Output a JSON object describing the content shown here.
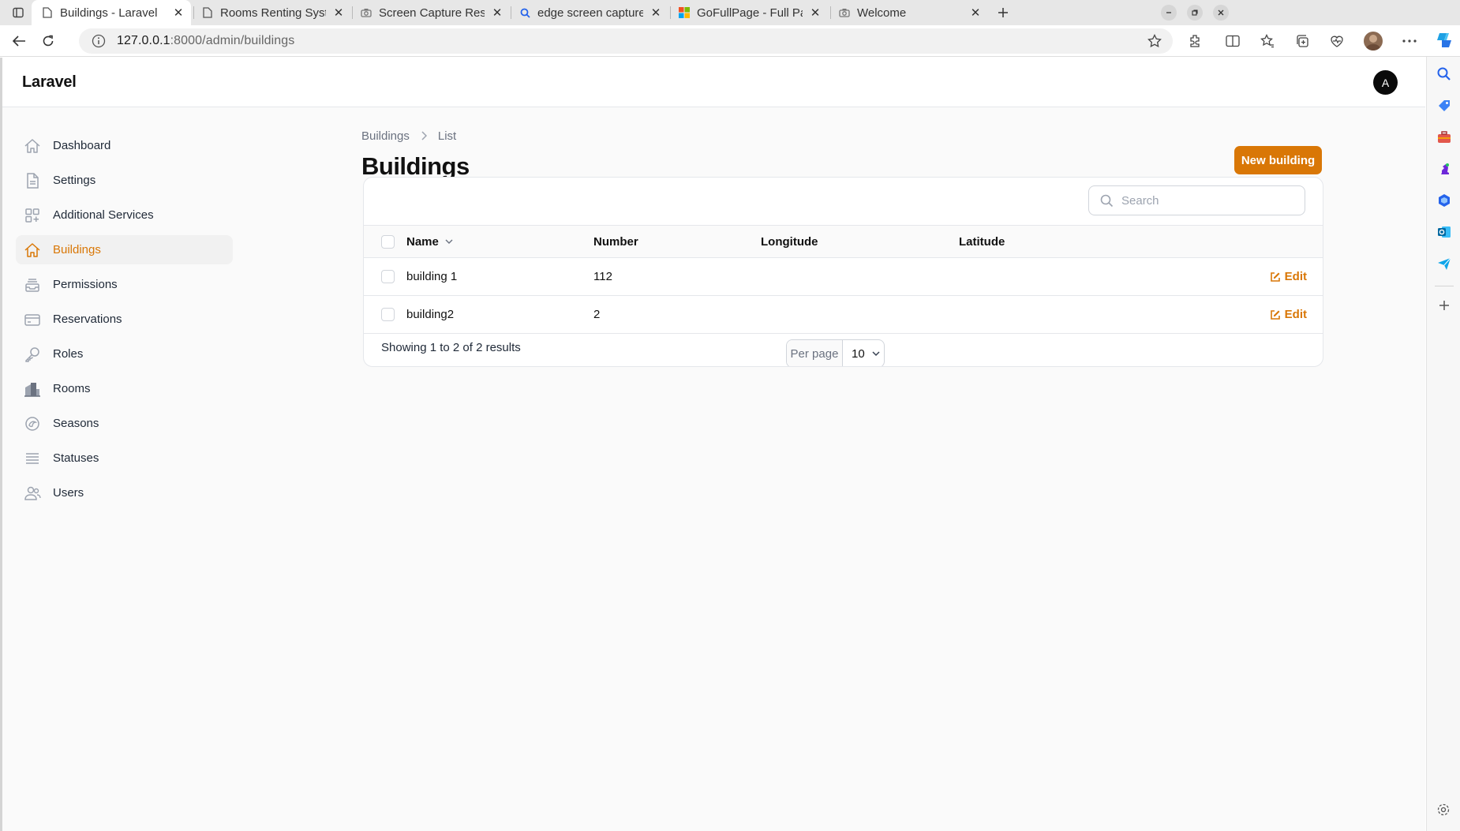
{
  "browser": {
    "tabs": [
      {
        "title": "Buildings - Laravel",
        "favicon": "page-icon",
        "active": true
      },
      {
        "title": "Rooms Renting System",
        "favicon": "page-icon",
        "active": false
      },
      {
        "title": "Screen Capture Result",
        "favicon": "camera-icon",
        "active": false
      },
      {
        "title": "edge screen capture exte",
        "favicon": "search-icon",
        "active": false
      },
      {
        "title": "GoFullPage - Full Page Scr",
        "favicon": "microsoft-icon",
        "active": false
      },
      {
        "title": "Welcome",
        "favicon": "camera-icon",
        "active": false
      }
    ],
    "url_host": "127.0.0.1",
    "url_path": ":8000/admin/buildings"
  },
  "app": {
    "brand": "Laravel",
    "avatar_initial": "A",
    "accent_color": "#d97706",
    "nav": [
      {
        "label": "Dashboard",
        "icon": "home-icon",
        "active": false
      },
      {
        "label": "Settings",
        "icon": "document-icon",
        "active": false
      },
      {
        "label": "Additional Services",
        "icon": "squares-icon",
        "active": false
      },
      {
        "label": "Buildings",
        "icon": "home-icon",
        "active": true
      },
      {
        "label": "Permissions",
        "icon": "inbox-stack-icon",
        "active": false
      },
      {
        "label": "Reservations",
        "icon": "credit-card-icon",
        "active": false
      },
      {
        "label": "Roles",
        "icon": "key-icon",
        "active": false
      },
      {
        "label": "Rooms",
        "icon": "building-icon",
        "active": false
      },
      {
        "label": "Seasons",
        "icon": "sun-icon",
        "active": false
      },
      {
        "label": "Statuses",
        "icon": "bars-icon",
        "active": false
      },
      {
        "label": "Users",
        "icon": "users-icon",
        "active": false
      }
    ]
  },
  "page": {
    "breadcrumb": [
      "Buildings",
      "List"
    ],
    "title": "Buildings",
    "new_button": "New building",
    "search_placeholder": "Search",
    "columns": {
      "name": "Name",
      "number": "Number",
      "longitude": "Longitude",
      "latitude": "Latitude"
    },
    "rows": [
      {
        "name": "building 1",
        "number": "112",
        "longitude": "",
        "latitude": "",
        "action": "Edit"
      },
      {
        "name": "building2",
        "number": "2",
        "longitude": "",
        "latitude": "",
        "action": "Edit"
      }
    ],
    "showing": "Showing 1 to 2 of 2 results",
    "per_page_label": "Per page",
    "per_page_value": "10"
  }
}
